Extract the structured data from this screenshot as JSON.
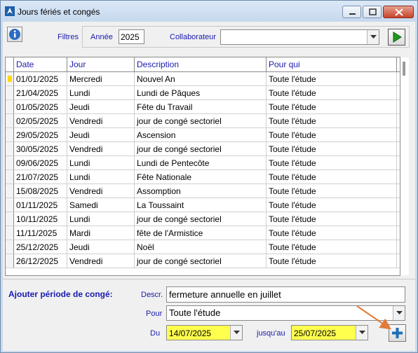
{
  "window": {
    "title": "Jours fériés et congés"
  },
  "filters": {
    "filtres_label": "Filtres",
    "annee_label": "Année",
    "annee_value": "2025",
    "collaborateur_label": "Collaborateur",
    "collaborateur_value": ""
  },
  "grid": {
    "columns": [
      "Date",
      "Jour",
      "Description",
      "Pour qui"
    ],
    "rows": [
      {
        "date": "01/01/2025",
        "jour": "Mercredi",
        "description": "Nouvel An",
        "pour": "Toute l'étude"
      },
      {
        "date": "21/04/2025",
        "jour": "Lundi",
        "description": "Lundi de Pâques",
        "pour": "Toute l'étude"
      },
      {
        "date": "01/05/2025",
        "jour": "Jeudi",
        "description": "Fête du Travail",
        "pour": "Toute l'étude"
      },
      {
        "date": "02/05/2025",
        "jour": "Vendredi",
        "description": "jour de congé sectoriel",
        "pour": "Toute l'étude"
      },
      {
        "date": "29/05/2025",
        "jour": "Jeudi",
        "description": "Ascension",
        "pour": "Toute l'étude"
      },
      {
        "date": "30/05/2025",
        "jour": "Vendredi",
        "description": "jour de congé sectoriel",
        "pour": "Toute l'étude"
      },
      {
        "date": "09/06/2025",
        "jour": "Lundi",
        "description": "Lundi de Pentecôte",
        "pour": "Toute l'étude"
      },
      {
        "date": "21/07/2025",
        "jour": "Lundi",
        "description": "Fête Nationale",
        "pour": "Toute l'étude"
      },
      {
        "date": "15/08/2025",
        "jour": "Vendredi",
        "description": "Assomption",
        "pour": "Toute l'étude"
      },
      {
        "date": "01/11/2025",
        "jour": "Samedi",
        "description": "La Toussaint",
        "pour": "Toute l'étude"
      },
      {
        "date": "10/11/2025",
        "jour": "Lundi",
        "description": "jour de congé sectoriel",
        "pour": "Toute l'étude"
      },
      {
        "date": "11/11/2025",
        "jour": "Mardi",
        "description": "fête de l'Armistice",
        "pour": "Toute l'étude"
      },
      {
        "date": "25/12/2025",
        "jour": "Jeudi",
        "description": "Noël",
        "pour": "Toute l'étude"
      },
      {
        "date": "26/12/2025",
        "jour": "Vendredi",
        "description": "jour de congé sectoriel",
        "pour": "Toute l'étude"
      }
    ]
  },
  "add_period": {
    "title": "Ajouter période de congé:",
    "descr_label": "Descr.",
    "descr_value": "fermeture annuelle en juillet",
    "pour_label": "Pour",
    "pour_value": "Toute l'étude",
    "du_label": "Du",
    "du_value": "14/07/2025",
    "jusquau_label": "jusqu'au",
    "jusquau_value": "25/07/2025"
  },
  "colors": {
    "header_text": "#1a1ab0",
    "highlight": "#ffff4d",
    "window_frame": "#c9daee",
    "annotation_arrow": "#e07b39",
    "go_button_green": "#1f9a1f",
    "add_button_plus": "#1f6fb5"
  },
  "icons": [
    "info-icon",
    "play-icon",
    "plus-icon",
    "chevron-down-icon",
    "app-icon"
  ]
}
